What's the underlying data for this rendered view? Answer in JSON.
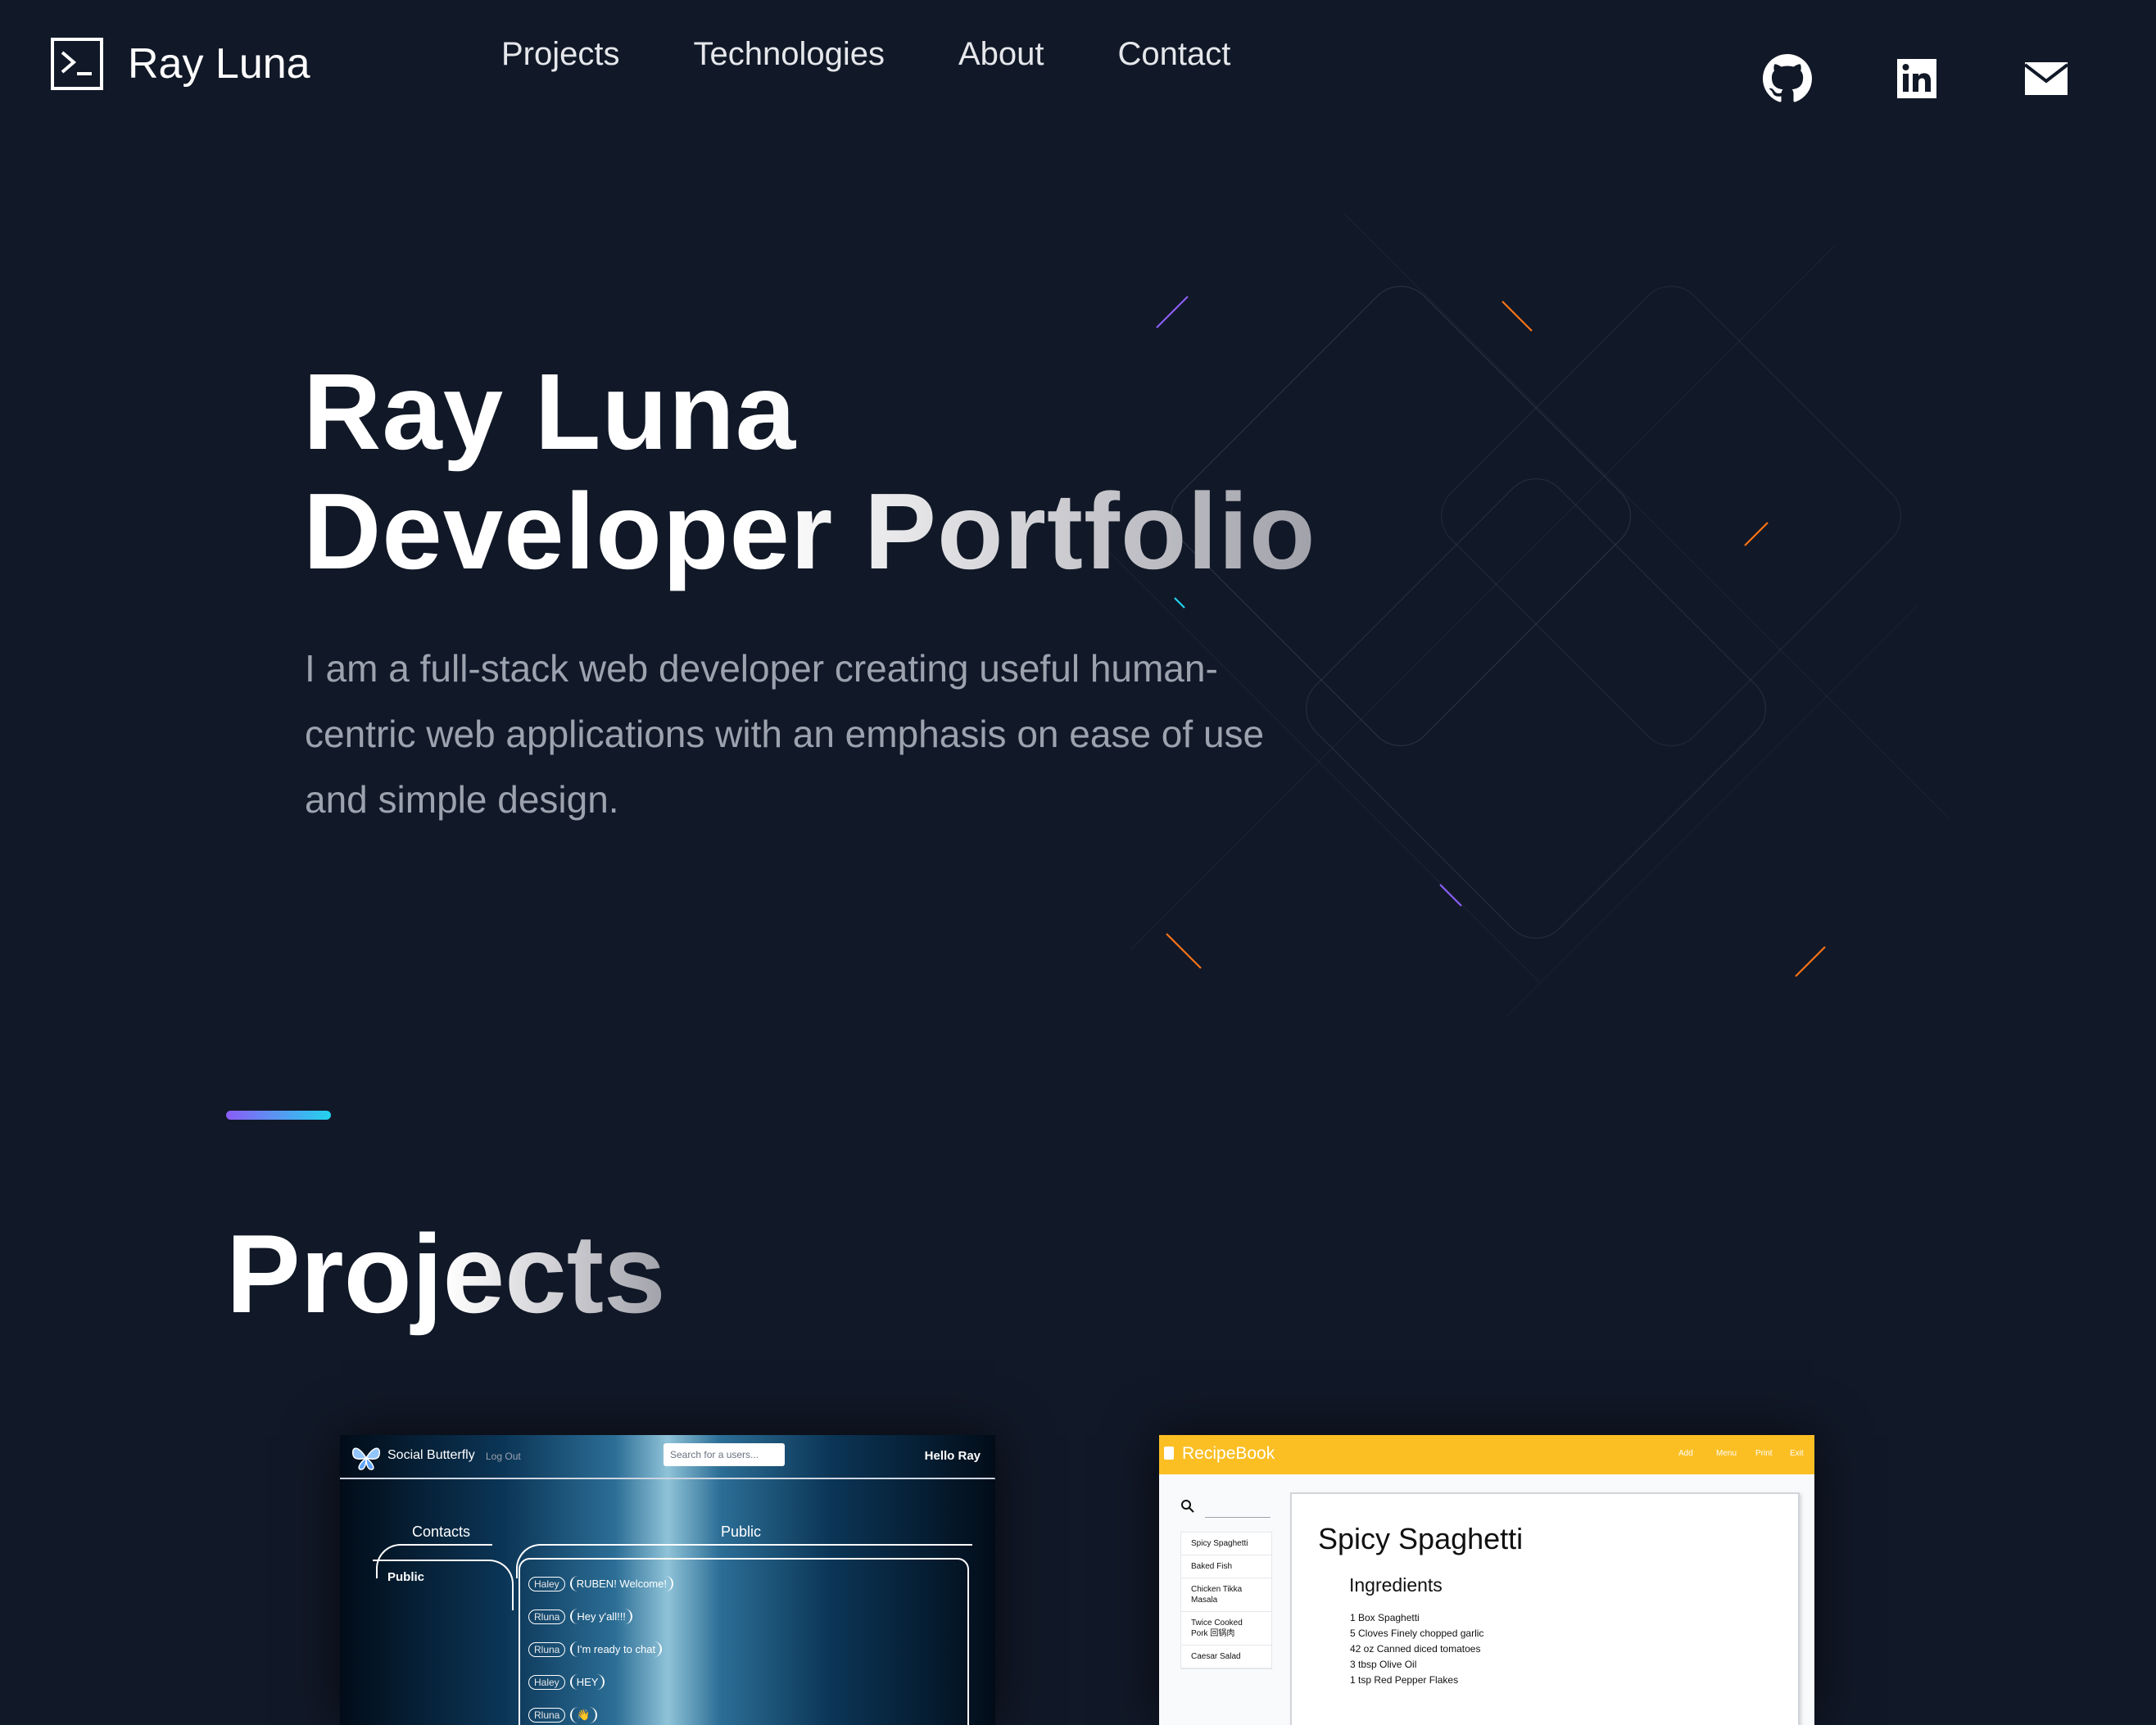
{
  "header": {
    "brand": "Ray Luna",
    "nav": [
      "Projects",
      "Technologies",
      "About",
      "Contact"
    ],
    "social": [
      "github-icon",
      "linkedin-icon",
      "mail-icon"
    ]
  },
  "hero": {
    "title_line1": "Ray Luna",
    "title_line2": "Developer Portfolio",
    "description": "I am a full-stack web developer creating useful human-centric web applications with an emphasis on ease of use and simple design."
  },
  "projects": {
    "heading": "Projects",
    "cards": [
      {
        "app": "Social Butterfly",
        "logout": "Log Out",
        "search_placeholder": "Search for a users...",
        "greeting": "Hello Ray",
        "contacts_tab": "Contacts",
        "public_tab": "Public",
        "contact_item": "Public",
        "messages": [
          {
            "user": "Haley",
            "text": "RUBEN! Welcome!"
          },
          {
            "user": "Rluna",
            "text": "Hey y'all!!!"
          },
          {
            "user": "Rluna",
            "text": "I'm ready to chat"
          },
          {
            "user": "Haley",
            "text": "HEY"
          },
          {
            "user": "Rluna",
            "text": "👋"
          }
        ]
      },
      {
        "app": "RecipeBook",
        "menu": [
          "Add",
          "Menu",
          "Print",
          "Exit"
        ],
        "recipes": [
          "Spicy Spaghetti",
          "Baked Fish",
          "Chicken Tikka Masala",
          "Twice Cooked Pork 回锅肉",
          "Caesar Salad"
        ],
        "recipe_title": "Spicy Spaghetti",
        "section": "Ingredients",
        "ingredients": [
          "1 Box Spaghetti",
          "5 Cloves Finely chopped garlic",
          "42 oz Canned diced tomatoes",
          "3 tbsp Olive Oil",
          "1 tsp Red Pepper Flakes"
        ]
      }
    ]
  },
  "colors": {
    "background": "#111827",
    "accent_start": "#8b5cf6",
    "accent_end": "#22d3ee",
    "recipe_bar": "#fbbf24"
  }
}
